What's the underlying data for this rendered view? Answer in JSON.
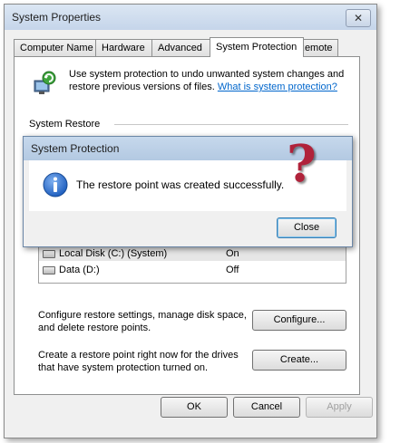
{
  "window": {
    "title": "System Properties",
    "close_glyph": "✕"
  },
  "tabs": [
    {
      "label": "Computer Name"
    },
    {
      "label": "Hardware"
    },
    {
      "label": "Advanced"
    },
    {
      "label": "System Protection"
    },
    {
      "label": "Remote"
    }
  ],
  "active_tab": "System Protection",
  "intro": {
    "text": "Use system protection to undo unwanted system changes and restore previous versions of files.",
    "link": "What is system protection?"
  },
  "system_restore": {
    "label": "System Restore"
  },
  "drives": [
    {
      "name": "Local Disk (C:) (System)",
      "status": "On"
    },
    {
      "name": "Data (D:)",
      "status": "Off"
    }
  ],
  "configure": {
    "text": "Configure restore settings, manage disk space, and delete restore points.",
    "button": "Configure..."
  },
  "create": {
    "text": "Create a restore point right now for the drives that have system protection turned on.",
    "button": "Create..."
  },
  "footer": {
    "ok": "OK",
    "cancel": "Cancel",
    "apply": "Apply"
  },
  "dialog": {
    "title": "System Protection",
    "message": "The restore point was created successfully.",
    "close": "Close"
  },
  "overlay": {
    "question_mark": "?"
  },
  "colors": {
    "link": "#0066cc",
    "question_mark": "#b0223a",
    "info_blue": "#1f5fbf"
  }
}
